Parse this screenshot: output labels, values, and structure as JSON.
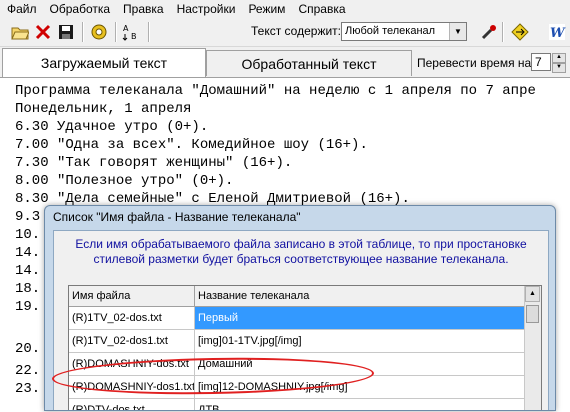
{
  "menu": [
    "Файл",
    "Обработка",
    "Правка",
    "Настройки",
    "Режим",
    "Справка"
  ],
  "toolbar": {
    "text_contains_label": "Текст содержит:",
    "channel_select_value": "Любой телеканал",
    "icons": [
      "open-folder-icon",
      "close-icon",
      "save-icon",
      "settings-gear-icon",
      "sort-ab-icon",
      "tools-icon",
      "cut-icon",
      "navigate-icon",
      "search-icon",
      "word-icon"
    ]
  },
  "tabs": {
    "loaded": "Загружаемый текст",
    "processed": "Обработанный текст"
  },
  "convert_time": {
    "label": "Перевести время на",
    "value": "7"
  },
  "text_lines": [
    "Программа телеканала \"Домашний\" на неделю с 1 апреля по 7 апре",
    "Понедельник, 1 апреля",
    "6.30 Удачное утро (0+).",
    "7.00 \"Одна за всех\". Комедийное шоу (16+).",
    "7.30 \"Так говорят женщины\" (16+).",
    "8.00 \"Полезное утро\" (0+).",
    "8.30 \"Дела семейные\" с Еленой Дмитриевой (16+).",
    "9.3",
    "10.",
    "14.",
    "14.",
    "18.",
    "19.",
    "20.",
    "22.",
    "23."
  ],
  "dialog": {
    "title": "Список  \"Имя файла - Название телеканала\"",
    "info_line1": "Если имя обрабатываемого файла записано в этой таблице, то при простановке",
    "info_line2": "стилевой разметки будет браться соответствующее название телеканала.",
    "columns": [
      "Имя файла",
      "Название телеканала"
    ],
    "rows": [
      {
        "file": "(R)1TV_02-dos.txt",
        "channel": "Первый"
      },
      {
        "file": "(R)1TV_02-dos1.txt",
        "channel": "[img]01-1TV.jpg[/img]"
      },
      {
        "file": "(R)DOMASHNIY-dos.txt",
        "channel": "Домашний"
      },
      {
        "file": "(R)DOMASHNIY-dos1.txt",
        "channel": "[img]12-DOMASHNIY.jpg[/img]"
      },
      {
        "file": "(R)DTV-dos.txt",
        "channel": "ДТВ"
      }
    ]
  },
  "colors": {
    "selection": "#3399ff",
    "info_text": "#1010a0",
    "annotation": "#e02020"
  }
}
